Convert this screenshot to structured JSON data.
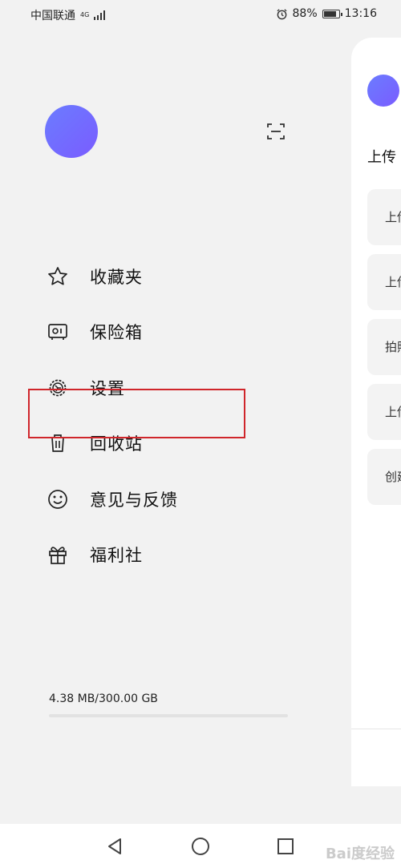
{
  "status_bar": {
    "carrier": "中国联通",
    "network": "4G",
    "battery": "88%",
    "battery_level": 0.88,
    "time": "13:16"
  },
  "drawer": {
    "menu": [
      {
        "label": "收藏夹",
        "icon": "star-icon"
      },
      {
        "label": "保险箱",
        "icon": "safe-icon"
      },
      {
        "label": "设置",
        "icon": "settings-icon"
      },
      {
        "label": "回收站",
        "icon": "trash-icon"
      },
      {
        "label": "意见与反馈",
        "icon": "smiley-icon"
      },
      {
        "label": "福利社",
        "icon": "gift-icon"
      }
    ],
    "storage": {
      "text": "4.38 MB/300.00 GB",
      "used_fraction": 1.46e-05
    }
  },
  "panel": {
    "title": "上传",
    "cards": [
      "上传",
      "上传",
      "拍照",
      "上传",
      "创建"
    ]
  },
  "watermark": "Bai度经验",
  "colors": {
    "accent": "#6b7cff",
    "highlight": "#d0262b",
    "background": "#f2f2f2"
  }
}
